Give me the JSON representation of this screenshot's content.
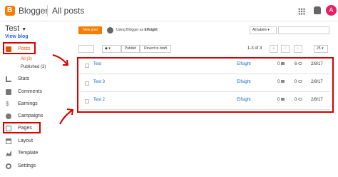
{
  "topbar": {
    "brand": "Blogger",
    "page_title": "All posts",
    "avatar_letter": "A"
  },
  "sidebar": {
    "blog_name": "Test",
    "view_blog": "View blog",
    "posts": "Posts",
    "sub_all": "All (3)",
    "sub_published": "Published (3)",
    "items": [
      "Stats",
      "Comments",
      "Earnings",
      "Campaigns",
      "Pages",
      "Layout",
      "Template",
      "Settings"
    ]
  },
  "toolbar": {
    "new_post": "New post",
    "using_prefix": "Using Blogger as",
    "using_name": "Elfsight",
    "labels_select": "All labels",
    "search_placeholder": ""
  },
  "actionbar": {
    "label_icon": "label-icon",
    "publish": "Publish",
    "revert": "Revert to draft",
    "page_range": "1-3 of 3",
    "first": "«",
    "prev": "‹",
    "next": "›",
    "per_page": "25"
  },
  "posts": [
    {
      "title": "Test",
      "author": "Elfsight",
      "comments": "0",
      "views": "6",
      "date": "2/8/17"
    },
    {
      "title": "Test 3",
      "author": "Elfsight",
      "comments": "0",
      "views": "0",
      "date": "2/8/17"
    },
    {
      "title": "Test 2",
      "author": "Elfsight",
      "comments": "0",
      "views": "0",
      "date": "2/8/17"
    }
  ],
  "colors": {
    "accent": "#f57d00",
    "highlight": "#d50000",
    "link": "#1565c0"
  }
}
